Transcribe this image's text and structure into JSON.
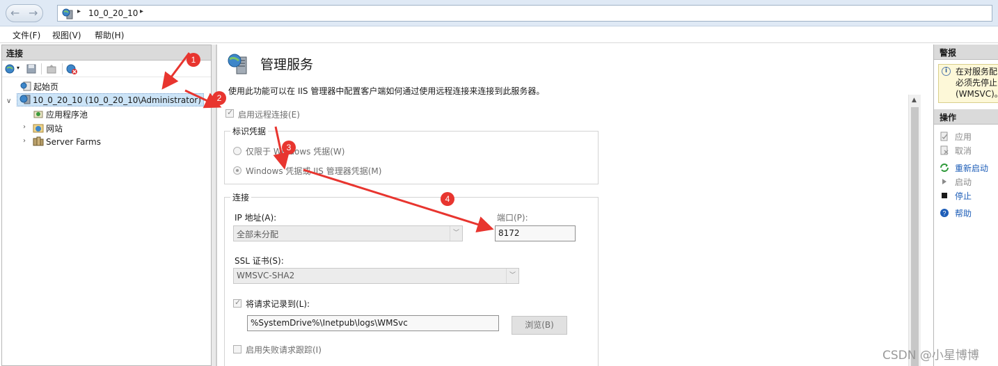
{
  "address_bar": {
    "breadcrumb": "10_0_20_10"
  },
  "menu": {
    "file": "文件(F)",
    "view": "视图(V)",
    "help": "帮助(H)"
  },
  "connections": {
    "header": "连接",
    "tree": {
      "start_page": "起始页",
      "server": "10_0_20_10 (10_0_20_10\\Administrator)",
      "app_pools": "应用程序池",
      "sites": "网站",
      "server_farms": "Server Farms"
    }
  },
  "page": {
    "title": "管理服务",
    "description": "使用此功能可以在 IIS 管理器中配置客户端如何通过使用远程连接来连接到此服务器。",
    "enable_remote": "启用远程连接(E)",
    "identity_group": {
      "title": "标识凭据",
      "option_windows_only": "仅限于 Windows 凭据(W)",
      "option_windows_or_iis": "Windows 凭据或 IIS 管理器凭据(M)",
      "selected": "Windows 凭据或 IIS 管理器凭据(M)"
    },
    "connection_group": {
      "title": "连接",
      "ip_label": "IP 地址(A):",
      "ip_value": "全部未分配",
      "port_label": "端口(P):",
      "port_value": "8172",
      "ssl_label": "SSL 证书(S):",
      "ssl_value": "WMSVC-SHA2",
      "log_label": "将请求记录到(L):",
      "log_path": "%SystemDrive%\\Inetpub\\logs\\WMSvc",
      "browse": "浏览(B)",
      "failed_tracing": "启用失败请求跟踪(I)"
    }
  },
  "alerts": {
    "header": "警报",
    "line1": "在对服务配",
    "line2": "必须先停止",
    "line3": "(WMSVC)。"
  },
  "actions": {
    "header": "操作",
    "apply": "应用",
    "cancel": "取消",
    "restart": "重新启动",
    "start": "启动",
    "stop": "停止",
    "help": "帮助"
  },
  "annotations": [
    "1",
    "2",
    "3",
    "4"
  ],
  "watermark": "CSDN @小星博博",
  "colors": {
    "annotation_red": "#e8352f",
    "link_blue": "#1e5eb8",
    "selection": "#cce4f7",
    "alert_bg": "#fdf8d8"
  }
}
